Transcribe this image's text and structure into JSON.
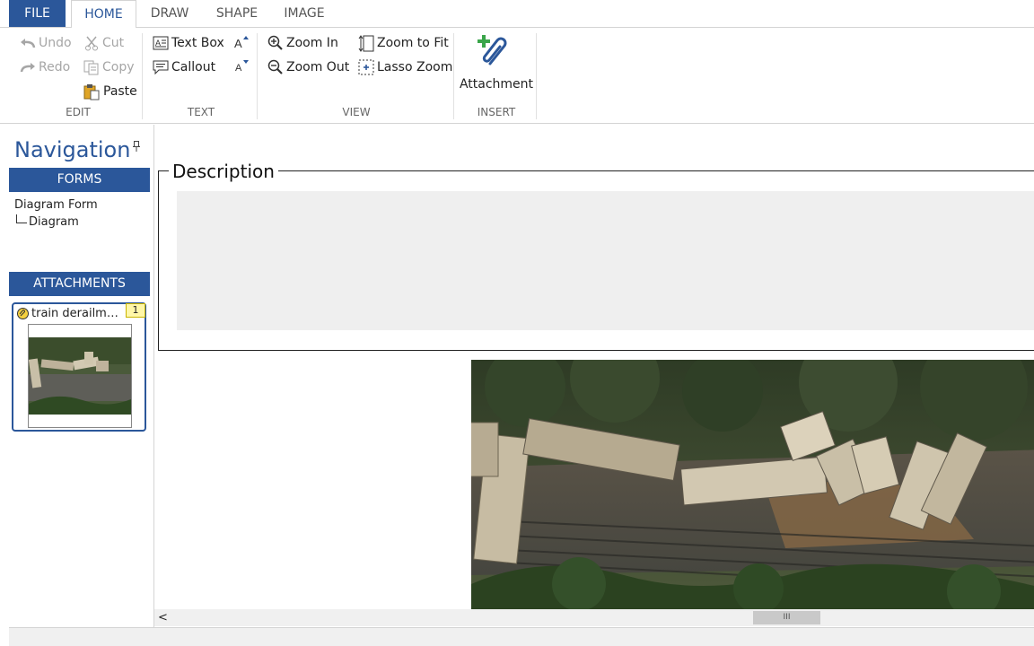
{
  "tabs": {
    "file": "FILE",
    "home": "HOME",
    "draw": "DRAW",
    "shape": "SHAPE",
    "image": "IMAGE"
  },
  "ribbon": {
    "edit": {
      "undo": "Undo",
      "redo": "Redo",
      "cut": "Cut",
      "copy": "Copy",
      "paste": "Paste",
      "group_label": "EDIT"
    },
    "text": {
      "text_box": "Text Box",
      "callout": "Callout",
      "group_label": "TEXT"
    },
    "view": {
      "zoom_in": "Zoom In",
      "zoom_out": "Zoom Out",
      "zoom_to_fit": "Zoom to Fit",
      "lasso_zoom": "Lasso Zoom",
      "group_label": "VIEW"
    },
    "insert": {
      "attachment": "Attachment",
      "group_label": "INSERT"
    }
  },
  "navigation": {
    "title": "Navigation",
    "forms_header": "FORMS",
    "tree": {
      "form": "Diagram Form",
      "child": "Diagram"
    },
    "attachments_header": "ATTACHMENTS",
    "attachment": {
      "name": "train derailmen...",
      "badge": "1"
    }
  },
  "main": {
    "description_legend": "Description"
  },
  "scrollbar": {
    "left_arrow": "<",
    "thumb_grip": "III"
  },
  "icons": [
    "undo-icon",
    "redo-icon",
    "cut-icon",
    "copy-icon",
    "paste-icon",
    "text-box-icon",
    "callout-icon",
    "font-grow-icon",
    "font-shrink-icon",
    "zoom-in-icon",
    "zoom-out-icon",
    "zoom-to-fit-icon",
    "lasso-zoom-icon",
    "attachment-icon",
    "pin-icon"
  ],
  "colors": {
    "accent": "#2b579a",
    "attachment_green": "#3aa54a",
    "badge": "#fff7a8"
  }
}
